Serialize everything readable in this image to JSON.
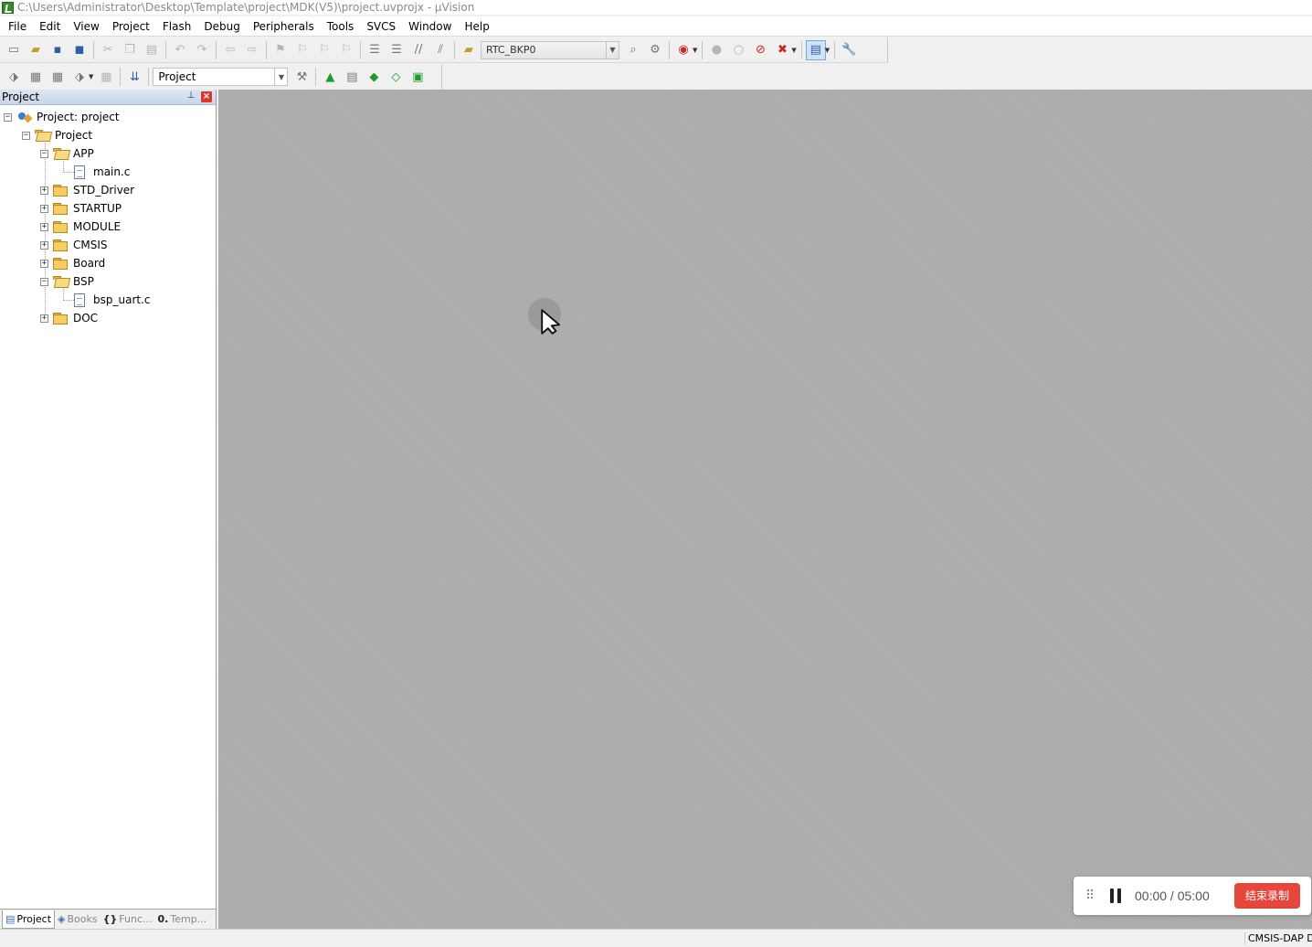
{
  "window": {
    "title": "C:\\Users\\Administrator\\Desktop\\Template\\project\\MDK(V5)\\project.uvprojx - µVision"
  },
  "menu": [
    "File",
    "Edit",
    "View",
    "Project",
    "Flash",
    "Debug",
    "Peripherals",
    "Tools",
    "SVCS",
    "Window",
    "Help"
  ],
  "toolbar": {
    "find_combo_value": "RTC_BKP0",
    "target_combo_value": "Project"
  },
  "panel": {
    "title": "Project",
    "pin_glyph": "⊥",
    "close_glyph": "×",
    "tree": {
      "root": "Project: project",
      "target": "Project",
      "groups": [
        {
          "name": "APP",
          "expanded": true,
          "files": [
            "main.c"
          ]
        },
        {
          "name": "STD_Driver",
          "expanded": false
        },
        {
          "name": "STARTUP",
          "expanded": false
        },
        {
          "name": "MODULE",
          "expanded": false
        },
        {
          "name": "CMSIS",
          "expanded": false
        },
        {
          "name": "Board",
          "expanded": false
        },
        {
          "name": "BSP",
          "expanded": true,
          "files": [
            "bsp_uart.c"
          ]
        },
        {
          "name": "DOC",
          "expanded": false
        }
      ]
    },
    "tabs": [
      {
        "label": "Project",
        "active": true,
        "icon": "project-tab-icon"
      },
      {
        "label": "Books",
        "active": false,
        "icon": "books-icon"
      },
      {
        "label": "Func...",
        "active": false,
        "icon": "braces-icon"
      },
      {
        "label": "Temp...",
        "active": false,
        "icon": "template-icon"
      }
    ]
  },
  "recorder": {
    "time": "00:00 / 05:00",
    "stop_label": "结束录制",
    "accent": "#e6473c"
  },
  "statusbar": {
    "debugger": "CMSIS-DAP De"
  },
  "colors": {
    "editor_bg": "#ababab",
    "panel_header": "#c9d6ea",
    "close_red": "#d83b2c"
  }
}
